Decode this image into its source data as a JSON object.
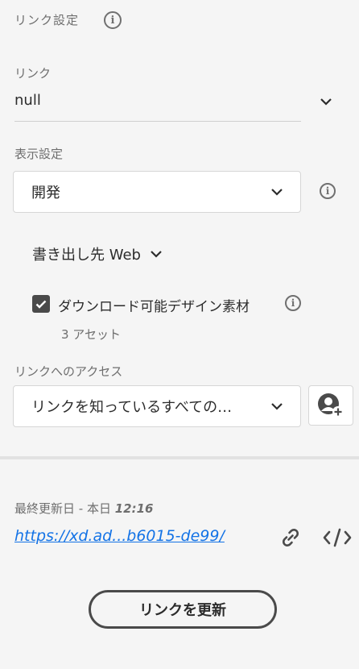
{
  "link_settings": {
    "title": "リンク設定",
    "link_label": "リンク",
    "link_value": "null"
  },
  "display_settings": {
    "label": "表示設定",
    "selected": "開発"
  },
  "export": {
    "label": "書き出し先 Web"
  },
  "download": {
    "checkbox_label": "ダウンロード可能デザイン素材",
    "checked": true,
    "asset_count": "3 アセット"
  },
  "access": {
    "label": "リンクへのアクセス",
    "selected": "リンクを知っているすべての…"
  },
  "footer": {
    "last_updated_prefix": "最終更新日 - 本日",
    "last_updated_time": "12:16",
    "url": "https://xd.ad...b6015-de99/",
    "update_button": "リンクを更新"
  },
  "colors": {
    "background": "#f5f5f5",
    "link": "#1473e6",
    "border": "#d6d6d6"
  },
  "icons": [
    "info-icon",
    "chevron-down-icon",
    "checkmark-icon",
    "add-user-icon",
    "link-icon",
    "embed-code-icon"
  ]
}
